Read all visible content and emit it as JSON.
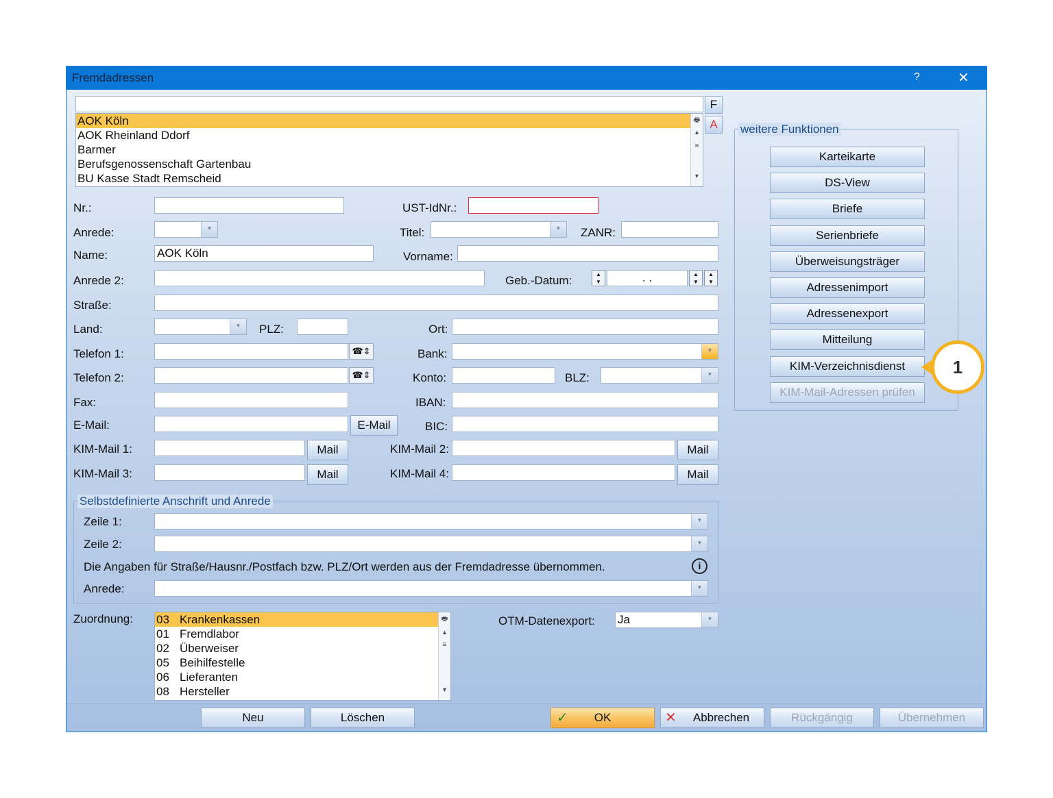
{
  "window": {
    "title": "Fremdadressen",
    "help": "?",
    "close": "✕"
  },
  "top_list": {
    "search_value": "",
    "items": [
      "AOK Köln",
      "AOK Rheinland Ddorf",
      "Barmer",
      "Berufsgenossenschaft Gartenbau",
      "BU Kasse Stadt Remscheid"
    ],
    "selected_index": 0,
    "btn_f": "F",
    "btn_a": "A"
  },
  "form": {
    "nr_label": "Nr.:",
    "nr_value": "",
    "ust_label": "UST-IdNr.:",
    "ust_value": "",
    "anrede_label": "Anrede:",
    "anrede_value": "",
    "titel_label": "Titel:",
    "titel_value": "",
    "zanr_label": "ZANR:",
    "zanr_value": "",
    "name_label": "Name:",
    "name_value": "AOK Köln",
    "vorname_label": "Vorname:",
    "vorname_value": "",
    "anrede2_label": "Anrede 2:",
    "anrede2_value": "",
    "gebdatum_label": "Geb.-Datum:",
    "gebdatum_value": ".   .",
    "strasse_label": "Straße:",
    "strasse_value": "",
    "land_label": "Land:",
    "land_value": "",
    "plz_label": "PLZ:",
    "plz_value": "",
    "ort_label": "Ort:",
    "ort_value": "",
    "telefon1_label": "Telefon 1:",
    "telefon1_value": "",
    "bank_label": "Bank:",
    "bank_value": "",
    "telefon2_label": "Telefon 2:",
    "telefon2_value": "",
    "konto_label": "Konto:",
    "konto_value": "",
    "blz_label": "BLZ:",
    "blz_value": "",
    "fax_label": "Fax:",
    "fax_value": "",
    "iban_label": "IBAN:",
    "iban_value": "",
    "email_label": "E-Mail:",
    "email_value": "",
    "email_button": "E-Mail",
    "bic_label": "BIC:",
    "bic_value": "",
    "kim1_label": "KIM-Mail 1:",
    "kim1_value": "",
    "kim2_label": "KIM-Mail 2:",
    "kim2_value": "",
    "kim3_label": "KIM-Mail 3:",
    "kim3_value": "",
    "kim4_label": "KIM-Mail 4:",
    "kim4_value": "",
    "mail_button": "Mail"
  },
  "custom_address": {
    "group_title": "Selbstdefinierte Anschrift und Anrede",
    "zeile1_label": "Zeile 1:",
    "zeile1_value": "",
    "zeile2_label": "Zeile 2:",
    "zeile2_value": "",
    "info_text": "Die Angaben für Straße/Hausnr./Postfach bzw. PLZ/Ort werden aus der Fremdadresse übernommen.",
    "anrede_label": "Anrede:",
    "anrede_value": ""
  },
  "zuordnung": {
    "label": "Zuordnung:",
    "items": [
      {
        "code": "03",
        "name": "Krankenkassen"
      },
      {
        "code": "01",
        "name": "Fremdlabor"
      },
      {
        "code": "02",
        "name": "Überweiser"
      },
      {
        "code": "05",
        "name": "Beihilfestelle"
      },
      {
        "code": "06",
        "name": "Lieferanten"
      },
      {
        "code": "08",
        "name": "Hersteller"
      }
    ],
    "selected_index": 0
  },
  "otm": {
    "label": "OTM-Datenexport:",
    "value": "Ja"
  },
  "functions": {
    "group_title": "weitere Funktionen",
    "buttons": [
      "Karteikarte",
      "DS-View",
      "Briefe",
      "Serienbriefe",
      "Überweisungsträger",
      "Adressenimport",
      "Adressenexport",
      "Mitteilung",
      "KIM-Verzeichnisdienst",
      "KIM-Mail-Adressen prüfen"
    ]
  },
  "callout": {
    "number": "1",
    "color": "#f5b323"
  },
  "bottom": {
    "neu": "Neu",
    "loeschen": "Löschen",
    "ok": "OK",
    "abbrechen": "Abbrechen",
    "rueckgaengig": "Rückgängig",
    "uebernehmen": "Übernehmen"
  },
  "colors": {
    "titlebar": "#0b78d7",
    "selection": "#f9c54d",
    "group_title": "#1c4e8c"
  }
}
